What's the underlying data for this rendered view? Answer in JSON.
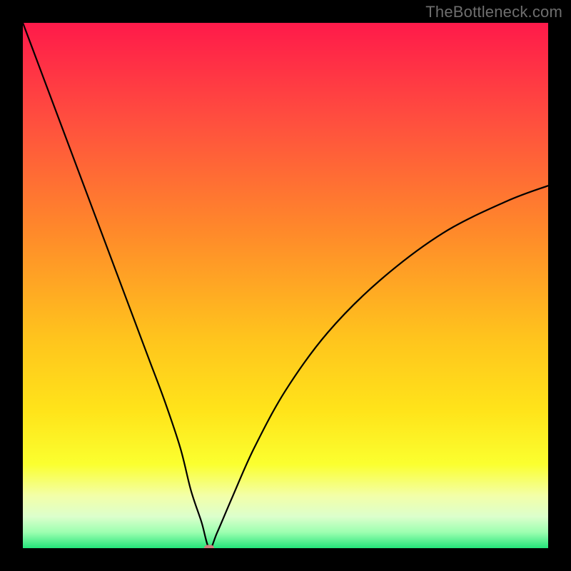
{
  "watermark": "TheBottleneck.com",
  "colors": {
    "frame": "#000000",
    "curve_stroke": "#000000",
    "marker": "#cf7f7d",
    "gradient_stops": [
      {
        "offset": 0.0,
        "color": "#ff1a4a"
      },
      {
        "offset": 0.18,
        "color": "#ff4d3f"
      },
      {
        "offset": 0.4,
        "color": "#ff8a2a"
      },
      {
        "offset": 0.6,
        "color": "#ffc41d"
      },
      {
        "offset": 0.74,
        "color": "#ffe41a"
      },
      {
        "offset": 0.84,
        "color": "#fbff2f"
      },
      {
        "offset": 0.9,
        "color": "#f3ffa8"
      },
      {
        "offset": 0.94,
        "color": "#dcffcc"
      },
      {
        "offset": 0.97,
        "color": "#9cffb0"
      },
      {
        "offset": 1.0,
        "color": "#24e57a"
      }
    ]
  },
  "chart_data": {
    "type": "line",
    "title": "",
    "xlabel": "",
    "ylabel": "",
    "xlim": [
      0,
      100
    ],
    "ylim": [
      0,
      100
    ],
    "grid": false,
    "legend": false,
    "series": [
      {
        "name": "bottleneck-curve",
        "x": [
          0,
          3,
          6,
          9,
          12,
          15,
          18,
          21,
          24,
          27,
          30,
          32,
          34,
          35.5,
          37,
          40,
          44,
          50,
          58,
          68,
          80,
          92,
          100
        ],
        "y": [
          100,
          92,
          84,
          76,
          68,
          60,
          52,
          44,
          36,
          28,
          19,
          11,
          5,
          0,
          3,
          10,
          19,
          30,
          41,
          51,
          60,
          66,
          69
        ]
      }
    ],
    "annotations": [
      {
        "name": "min-marker",
        "x": 35.5,
        "y": 0
      }
    ]
  }
}
